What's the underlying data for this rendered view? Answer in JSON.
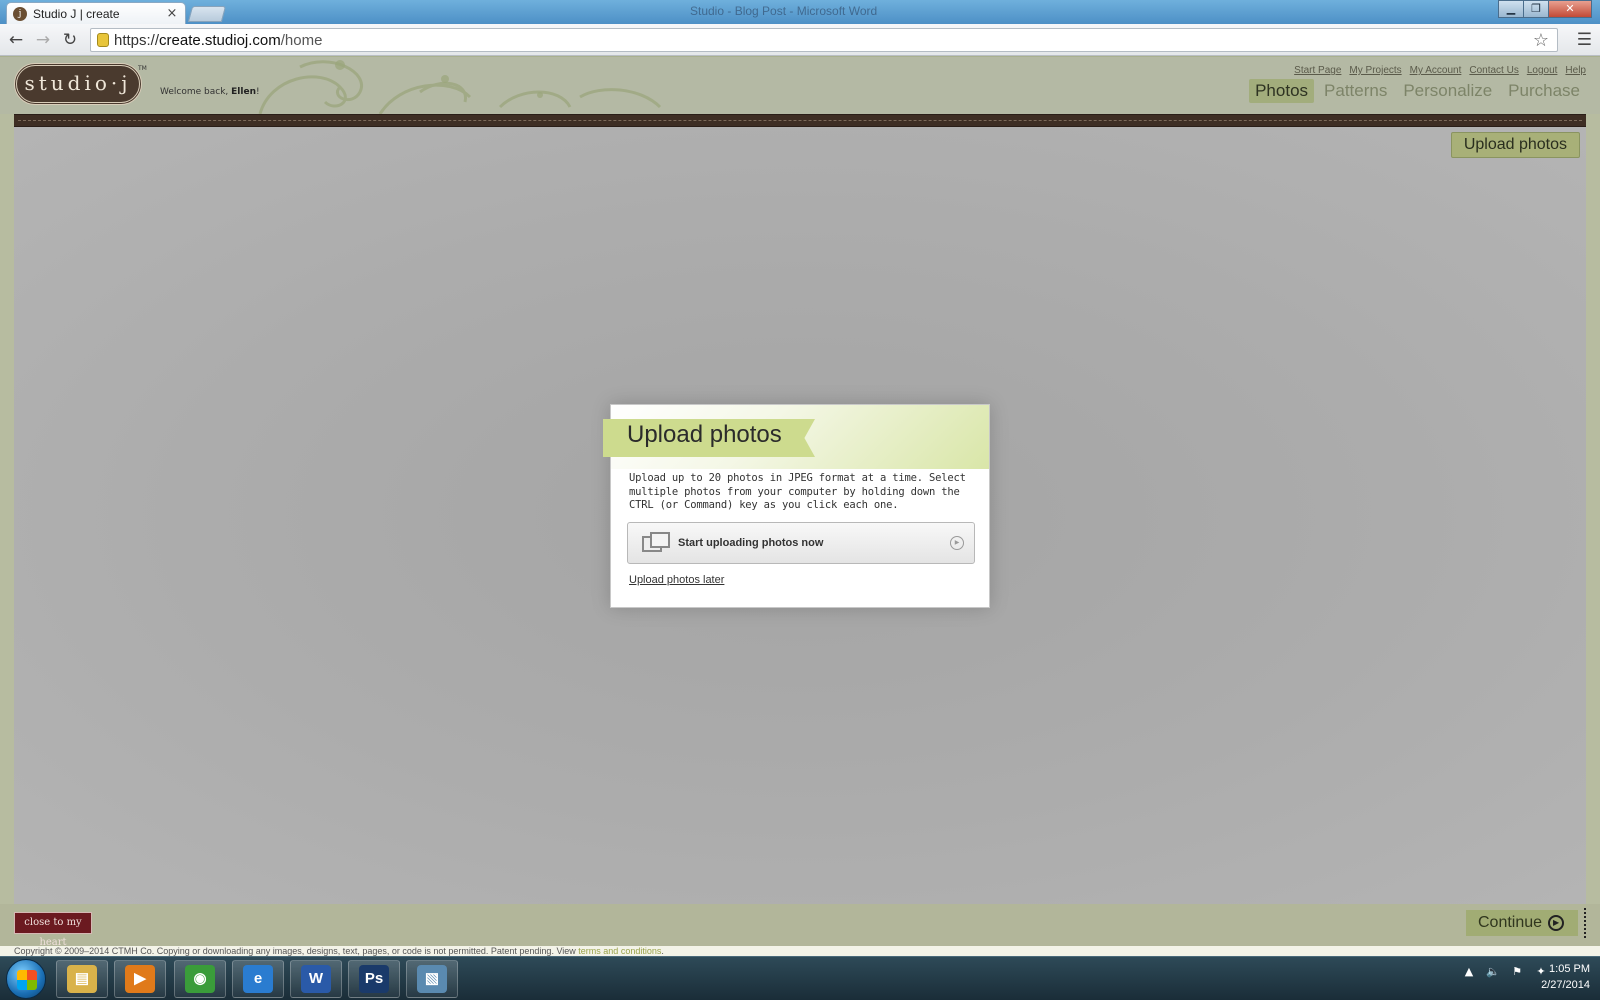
{
  "browser": {
    "tab_title": "Studio J | create",
    "tab_close": "×",
    "window_title": "Studio - Blog Post - Microsoft Word",
    "url_scheme": "https://",
    "url_host": "create.studioj.com",
    "url_path": "/home"
  },
  "header": {
    "logo_text": "studio·j",
    "logo_tm": "TM",
    "welcome_prefix": "Welcome back, ",
    "user_name": "Ellen",
    "welcome_suffix": "!",
    "top_links": [
      "Start Page",
      "My Projects",
      "My Account",
      "Contact Us",
      "Logout",
      "Help"
    ],
    "nav": [
      {
        "label": "Photos",
        "active": true
      },
      {
        "label": "Patterns",
        "active": false
      },
      {
        "label": "Personalize",
        "active": false
      },
      {
        "label": "Purchase",
        "active": false
      }
    ]
  },
  "toolbar": {
    "upload_photos_label": "Upload photos"
  },
  "modal": {
    "title": "Upload photos",
    "description": "Upload up to 20 photos in JPEG format at a time. Select multiple photos from your computer by holding down the CTRL (or Command) key as you click each one.",
    "start_button_label": "Start uploading photos now",
    "later_link": "Upload photos later"
  },
  "footer": {
    "brand": "close to my heart",
    "continue_label": "Continue",
    "copyright_text": "Copyright © 2009–2014 CTMH Co. Copying or downloading any images, designs, text, pages, or code is not permitted. Patent pending. View ",
    "terms_link": "terms and conditions",
    "copyright_end": "."
  },
  "taskbar": {
    "apps": [
      {
        "name": "file-explorer-icon",
        "glyph": "▤",
        "color": "#d9b24a"
      },
      {
        "name": "media-player-icon",
        "glyph": "▶",
        "color": "#e07a1a"
      },
      {
        "name": "chrome-icon",
        "glyph": "◉",
        "color": "#3a9c3a"
      },
      {
        "name": "internet-explorer-icon",
        "glyph": "e",
        "color": "#2a7cd0"
      },
      {
        "name": "word-icon",
        "glyph": "W",
        "color": "#2a5aa8"
      },
      {
        "name": "photoshop-icon",
        "glyph": "Ps",
        "color": "#1a3a6a"
      },
      {
        "name": "photo-viewer-icon",
        "glyph": "▧",
        "color": "#5a8ab0"
      }
    ],
    "time": "1:05 PM",
    "date": "2/27/2014"
  }
}
